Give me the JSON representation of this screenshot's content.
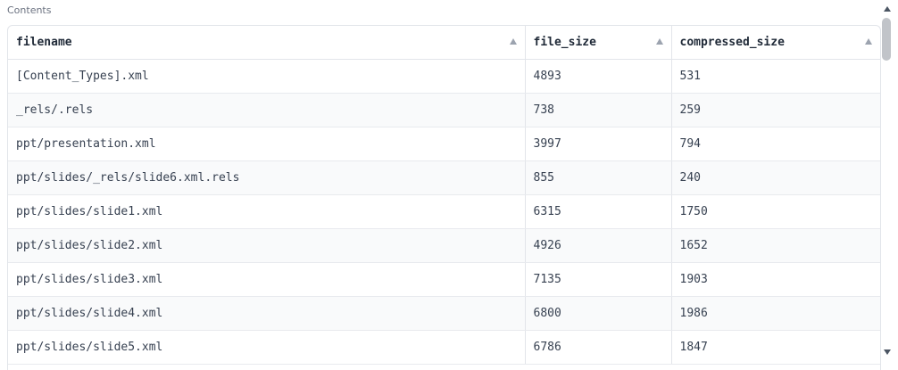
{
  "section": {
    "label": "Contents"
  },
  "table": {
    "columns": [
      "filename",
      "file_size",
      "compressed_size"
    ],
    "rows": [
      [
        "[Content_Types].xml",
        "4893",
        "531"
      ],
      [
        "_rels/.rels",
        "738",
        "259"
      ],
      [
        "ppt/presentation.xml",
        "3997",
        "794"
      ],
      [
        "ppt/slides/_rels/slide6.xml.rels",
        "855",
        "240"
      ],
      [
        "ppt/slides/slide1.xml",
        "6315",
        "1750"
      ],
      [
        "ppt/slides/slide2.xml",
        "4926",
        "1652"
      ],
      [
        "ppt/slides/slide3.xml",
        "7135",
        "1903"
      ],
      [
        "ppt/slides/slide4.xml",
        "6800",
        "1986"
      ],
      [
        "ppt/slides/slide5.xml",
        "6786",
        "1847"
      ]
    ]
  },
  "icons": {
    "sort": "sort-ascending-icon",
    "scroll_up": "scroll-up-arrow-icon",
    "scroll_down": "scroll-down-arrow-icon"
  }
}
